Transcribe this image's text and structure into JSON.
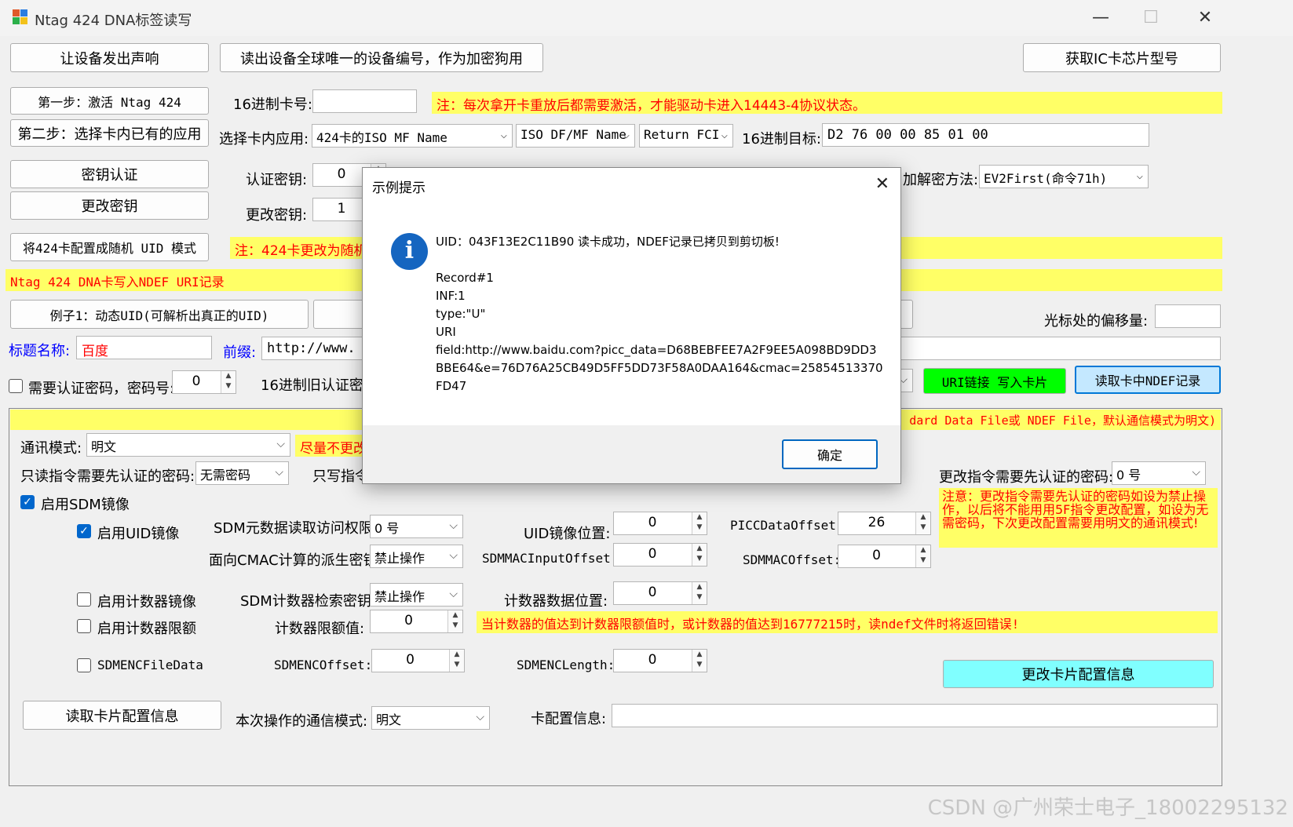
{
  "window": {
    "title": "Ntag 424 DNA标签读写",
    "minimize": "—",
    "maximize": "☐",
    "close": "✕"
  },
  "top": {
    "beep_btn": "让设备发出声响",
    "uid_btn": "读出设备全球唯一的设备编号，作为加密狗用",
    "chip_btn": "获取IC卡芯片型号"
  },
  "step1": {
    "btn": "第一步：激活 Ntag 424",
    "hex_label": "16进制卡号:",
    "hex_value": "",
    "note": "注：每次拿开卡重放后都需要激活，才能驱动卡进入14443-4协议状态。"
  },
  "step2": {
    "btn": "第二步：选择卡内已有的应用",
    "app_label": "选择卡内应用:",
    "app_value": "424卡的ISO MF Name",
    "df_value": "ISO DF/MF Name",
    "fci_value": "Return FCI",
    "target_label": "16进制目标:",
    "target_value": "D2 76 00 00 85 01 00"
  },
  "auth": {
    "btn": "密钥认证",
    "label": "认证密钥:",
    "value": "0",
    "method_label": "加解密方法:",
    "method_value": "EV2First(命令71h)"
  },
  "change_key": {
    "btn": "更改密钥",
    "label": "更改密钥:",
    "value": "1"
  },
  "random_uid": {
    "btn": "将424卡配置成随机 UID 模式",
    "note": "注：424卡更改为随机"
  },
  "ndef_heading": "Ntag 424 DNA卡写入NDEF URI记录",
  "example": {
    "btn": "例子1：动态UID(可解析出真正的UID)",
    "offset_label": "光标处的偏移量:",
    "offset_value": ""
  },
  "uri": {
    "title_label": "标题名称:",
    "title_value": "百度",
    "prefix_label": "前缀:",
    "prefix_value": "http://www."
  },
  "auth_pwd": {
    "label": "需要认证密码，密码号:",
    "value": "0",
    "old_key_label": "16进制旧认证密钥",
    "write_btn": "URI链接 写入卡片",
    "read_btn": "读取卡中NDEF记录"
  },
  "group": {
    "note_right": "dard Data File或 NDEF File，默认通信模式为明文)",
    "comm_label": "通讯模式:",
    "comm_value": "明文",
    "comm_note": "尽量不更改",
    "readonly_label": "只读指令需要先认证的密码:",
    "readonly_value": "无需密码",
    "writeonly_label": "只写指令",
    "change_pwd_label": "更改指令需要先认证的密码:",
    "change_pwd_value": "0 号",
    "change_note": "注意：更改指令需要先认证的密码如设为禁止操作，以后将不能用用5F指令更改配置，如设为无需密码，下次更改配置需要用明文的通讯模式!",
    "sdm_mirror": "启用SDM镜像",
    "uid_mirror": "启用UID镜像",
    "sdm_meta_label": "SDM元数据读取访问权限:",
    "sdm_meta_value": "0 号",
    "uid_pos_label": "UID镜像位置:",
    "uid_pos_value": "0",
    "picc_label": "PICCDataOffset:",
    "picc_value": "26",
    "cmac_key_label": "面向CMAC计算的派生密钥:",
    "cmac_key_value": "禁止操作",
    "macin_label": "SDMMACInputOffset:",
    "macin_value": "0",
    "macoff_label": "SDMMACOffset:",
    "macoff_value": "0",
    "counter_mirror": "启用计数器镜像",
    "counter_key_label": "SDM计数器检索密钥:",
    "counter_key_value": "禁止操作",
    "counter_pos_label": "计数器数据位置:",
    "counter_pos_value": "0",
    "counter_limit": "启用计数器限额",
    "limit_label": "计数器限额值:",
    "limit_value": "0",
    "limit_note": "当计数器的值达到计数器限额值时，或计数器的值达到16777215时，读ndef文件时将返回错误!",
    "enc_file": "SDMENCFileData",
    "enc_off_label": "SDMENCOffset:",
    "enc_off_value": "0",
    "enc_len_label": "SDMENCLength:",
    "enc_len_value": "0",
    "change_cfg_btn": "更改卡片配置信息",
    "read_cfg_btn": "读取卡片配置信息",
    "op_mode_label": "本次操作的通信模式:",
    "op_mode_value": "明文",
    "cfg_info_label": "卡配置信息:",
    "cfg_info_value": ""
  },
  "dialog": {
    "title": "示例提示",
    "close": "✕",
    "icon": "i",
    "message": "UID：043F13E2C11B90 读卡成功，NDEF记录已拷贝到剪切板!\n\nRecord#1\nINF:1\ntype:\"U\"\nURI\nfield:http://www.baidu.com?picc_data=D68BEBFEE7A2F9EE5A098BD9DD3BBE64&e=76D76A25CB49D5FF5DD73F58A0DAA164&cmac=25854513370FD47",
    "ok": "确定"
  },
  "watermark": "CSDN @广州荣士电子_18002295132",
  "icons": {
    "dropdown": "chevron-down-icon",
    "info": "info-icon",
    "check": "checkmark-icon"
  },
  "colors": {
    "note_bg": "#ffff66",
    "note_text": "#ff0000",
    "write_btn": "#00ff00",
    "read_btn": "#c4e8ff",
    "change_btn": "#80ffff",
    "link_blue": "#0000ff"
  }
}
